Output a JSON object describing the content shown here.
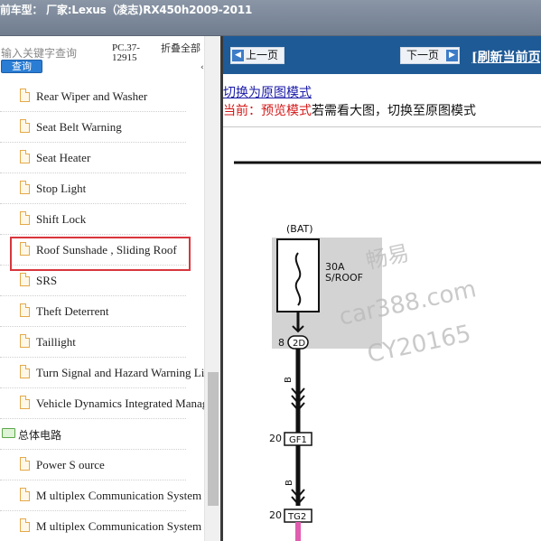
{
  "window": {
    "title": "前车型： 厂家:Lexus（凌志)RX450h2009-2011"
  },
  "left_panel": {
    "search_placeholder": "输入关键字查询",
    "search_button": "查询",
    "pc_code": "PC.37-12915",
    "collapse_all": "折叠全部",
    "items": [
      {
        "label": "Rear Wiper and Washer",
        "type": "doc"
      },
      {
        "label": "Seat Belt Warning",
        "type": "doc"
      },
      {
        "label": "Seat Heater",
        "type": "doc"
      },
      {
        "label": "Stop Light",
        "type": "doc"
      },
      {
        "label": "Shift Lock",
        "type": "doc"
      },
      {
        "label": "Roof Sunshade , Sliding Roof",
        "type": "doc"
      },
      {
        "label": "SRS",
        "type": "doc"
      },
      {
        "label": "Theft Deterrent",
        "type": "doc"
      },
      {
        "label": "Taillight",
        "type": "doc"
      },
      {
        "label": "Turn Signal and Hazard Warning Light",
        "type": "doc"
      },
      {
        "label": "Vehicle Dynamics Integrated Management",
        "type": "doc"
      },
      {
        "label": "总体电路",
        "type": "folder"
      },
      {
        "label": "Power S ource",
        "type": "doc"
      },
      {
        "label": "M ultiplex Communication System",
        "type": "doc"
      },
      {
        "label": "M ultiplex Communication System",
        "type": "doc"
      }
    ]
  },
  "toolbar": {
    "prev_label": "上一页",
    "next_label": "下一页",
    "refresh_label": "[刷新当前页]"
  },
  "content": {
    "switch_link": "切换为原图模式",
    "mode_current": "当前：预览模式",
    "mode_hint": "若需看大图，切换至原图模式"
  },
  "diagram": {
    "bat_label": "(BAT)",
    "fuse_rating": "30A",
    "fuse_name": "S/ROOF",
    "conn1_pin": "8",
    "conn1_name": "2D",
    "wire1_color_code": "B",
    "conn2_pin": "20",
    "conn2_name": "GF1",
    "wire2_color_code": "B",
    "conn3_pin": "20",
    "conn3_name": "TG2",
    "watermark_line1": "畅易",
    "watermark_line2": "car388.com",
    "watermark_line3": "CY20165",
    "colors": {
      "wire_black": "#111111",
      "wire_pink": "#e05db0",
      "fuse_bg": "#d3d3d3",
      "nav_blue": "#1e5a96"
    }
  }
}
